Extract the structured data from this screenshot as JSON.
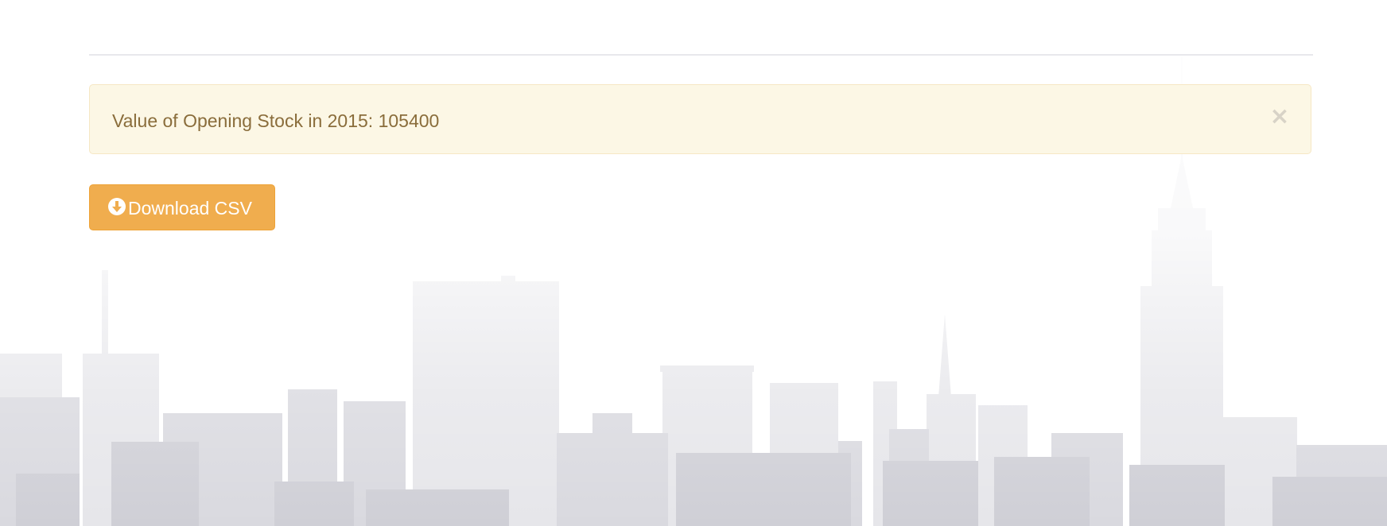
{
  "alert": {
    "message": "Value of Opening Stock in 2015: 105400",
    "close_glyph": "×",
    "close_icon": "close-icon"
  },
  "actions": {
    "download_label": "Download CSV",
    "download_icon": "download-circle-icon"
  },
  "colors": {
    "alert_bg": "#fcf8e3",
    "alert_text": "#8a6d3b",
    "button_bg": "#f0ad4e",
    "button_text": "#ffffff"
  },
  "background": {
    "decoration": "city-skyline"
  }
}
